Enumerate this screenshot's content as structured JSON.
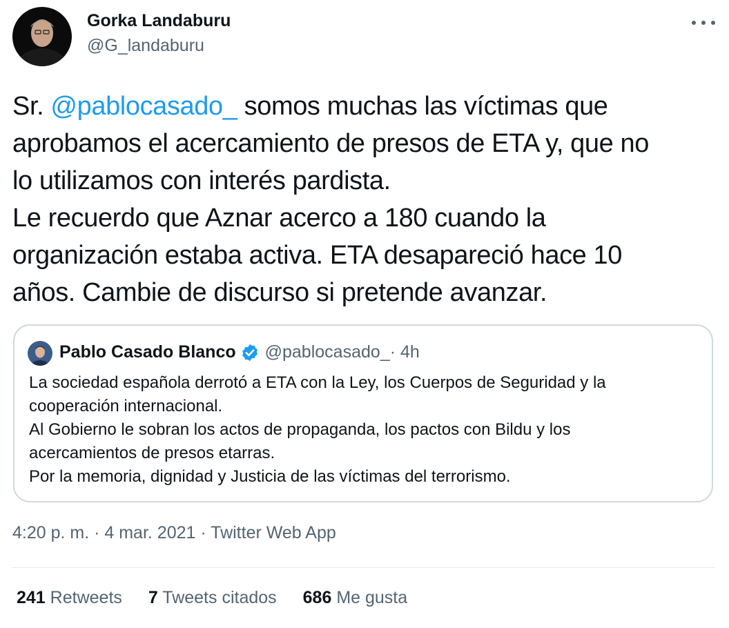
{
  "author": {
    "name": "Gorka Landaburu",
    "handle": "@G_landaburu"
  },
  "tweet": {
    "lines": [
      [
        "Sr. ",
        "@pablocasado_",
        " somos muchas las víctimas  que"
      ],
      "aprobamos el acercamiento de presos de ETA y, que no",
      "lo utilizamos con interés pardista.",
      "Le recuerdo que Aznar acerco a 180 cuando la",
      "organización estaba activa. ETA desapareció hace 10",
      "años. Cambie de discurso si pretende avanzar."
    ]
  },
  "quote": {
    "name": "Pablo Casado Blanco",
    "handle": "@pablocasado_",
    "time": " · 4h",
    "lines": [
      "La sociedad española derrotó a ETA con la Ley, los Cuerpos de Seguridad y la",
      "cooperación internacional.",
      "Al Gobierno le sobran los actos de propaganda, los pactos con Bildu y los",
      "acercamientos de presos etarras.",
      "Por la memoria, dignidad y Justicia de las víctimas del terrorismo."
    ]
  },
  "meta": "4:20 p. m. · 4 mar. 2021 · Twitter Web App",
  "stats": {
    "retweets_count": "241",
    "retweets_label": "Retweets",
    "quotes_count": "7",
    "quotes_label": "Tweets citados",
    "likes_count": "686",
    "likes_label": "Me gusta"
  },
  "colors": {
    "accent": "#1d9bf0",
    "secondary_text": "#536471",
    "border": "#cfd9de"
  },
  "icons": [
    "more-icon",
    "verified-badge-icon"
  ]
}
